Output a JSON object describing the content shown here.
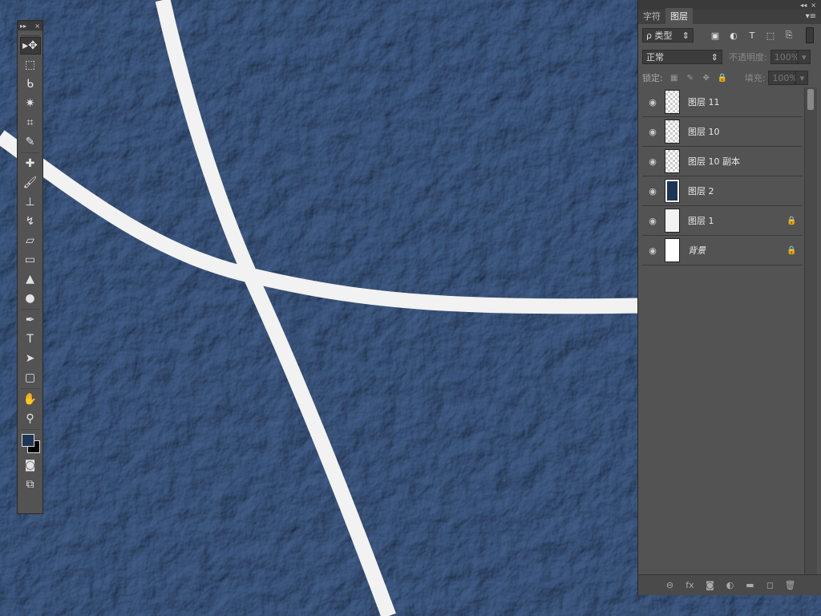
{
  "tools_panel": {
    "collapse_glyph": "▸▸",
    "close_glyph": "×",
    "tools": [
      {
        "name": "move-tool",
        "glyph": "▸✥",
        "active": true
      },
      {
        "name": "marquee-tool",
        "glyph": "⬚"
      },
      {
        "name": "lasso-tool",
        "glyph": "ᑲ"
      },
      {
        "name": "magic-wand-tool",
        "glyph": "✷"
      },
      {
        "name": "crop-tool",
        "glyph": "⌗"
      },
      {
        "name": "eyedropper-tool",
        "glyph": "✎"
      },
      {
        "name": "healing-brush-tool",
        "glyph": "✚"
      },
      {
        "name": "brush-tool",
        "glyph": "🖌"
      },
      {
        "name": "stamp-tool",
        "glyph": "⊥"
      },
      {
        "name": "history-brush-tool",
        "glyph": "↯"
      },
      {
        "name": "eraser-tool",
        "glyph": "▱"
      },
      {
        "name": "gradient-tool",
        "glyph": "▭"
      },
      {
        "name": "blur-tool",
        "glyph": "▲"
      },
      {
        "name": "dodge-tool",
        "glyph": "●"
      },
      {
        "name": "pen-tool",
        "glyph": "✒"
      },
      {
        "name": "type-tool",
        "glyph": "T"
      },
      {
        "name": "path-selection-tool",
        "glyph": "➤"
      },
      {
        "name": "shape-tool",
        "glyph": "▢"
      },
      {
        "name": "hand-tool",
        "glyph": "✋"
      },
      {
        "name": "zoom-tool",
        "glyph": "⚲"
      }
    ],
    "mask_glyph": "◙",
    "screen_mode_glyph": "⧉"
  },
  "layers_panel": {
    "collapse_glyph": "◂◂",
    "close_glyph": "×",
    "tabs": [
      "字符",
      "图层"
    ],
    "active_tab": "图层",
    "menu_glyph": "▾≡",
    "filter_kind": "ρ 类型",
    "filter_icons": [
      "image-filter-icon",
      "adjustment-filter-icon",
      "type-filter-icon",
      "shape-filter-icon",
      "smart-object-filter-icon"
    ],
    "filter_glyphs": [
      "▣",
      "◐",
      "T",
      "⬚",
      "⎘"
    ],
    "blend_mode": "正常",
    "opacity_label": "不透明度:",
    "opacity_value": "100%",
    "lock_label": "锁定:",
    "fill_label": "填充:",
    "fill_value": "100%",
    "layers": [
      {
        "name": "图层 11",
        "thumb": "check",
        "locked": false
      },
      {
        "name": "图层 10",
        "thumb": "check",
        "locked": false
      },
      {
        "name": "图层 10 副本",
        "thumb": "check",
        "locked": false
      },
      {
        "name": "图层 2",
        "thumb": "navy",
        "locked": false
      },
      {
        "name": "图层 1",
        "thumb": "light",
        "locked": true
      },
      {
        "name": "背景",
        "thumb": "white",
        "locked": true,
        "italic": true
      }
    ],
    "bottom_icons": [
      "link-layers-icon",
      "fx-icon",
      "add-mask-icon",
      "adjustment-layer-icon",
      "new-group-icon",
      "new-layer-icon",
      "delete-layer-icon"
    ],
    "bottom_glyphs": [
      "⊖",
      "fx",
      "◙",
      "◐",
      "▬",
      "◻",
      "🗑"
    ]
  },
  "colors": {
    "canvas_bg": "#2d4468",
    "stroke": "#f2f2f2",
    "foreground": "#1f3555",
    "background": "#000000",
    "panel": "#535353"
  }
}
